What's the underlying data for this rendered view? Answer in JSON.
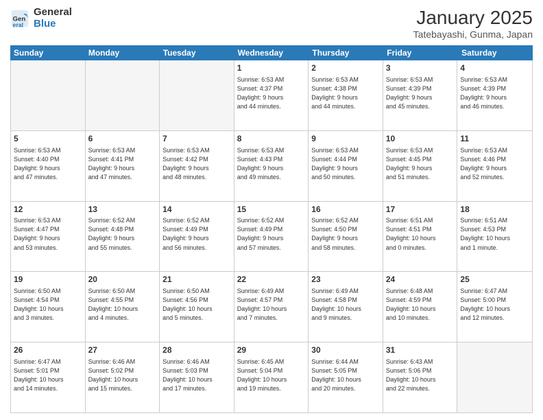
{
  "header": {
    "logo_general": "General",
    "logo_blue": "Blue",
    "month_title": "January 2025",
    "location": "Tatebayashi, Gunma, Japan"
  },
  "days_of_week": [
    "Sunday",
    "Monday",
    "Tuesday",
    "Wednesday",
    "Thursday",
    "Friday",
    "Saturday"
  ],
  "weeks": [
    [
      {
        "day": "",
        "info": ""
      },
      {
        "day": "",
        "info": ""
      },
      {
        "day": "",
        "info": ""
      },
      {
        "day": "1",
        "info": "Sunrise: 6:53 AM\nSunset: 4:37 PM\nDaylight: 9 hours\nand 44 minutes."
      },
      {
        "day": "2",
        "info": "Sunrise: 6:53 AM\nSunset: 4:38 PM\nDaylight: 9 hours\nand 44 minutes."
      },
      {
        "day": "3",
        "info": "Sunrise: 6:53 AM\nSunset: 4:39 PM\nDaylight: 9 hours\nand 45 minutes."
      },
      {
        "day": "4",
        "info": "Sunrise: 6:53 AM\nSunset: 4:39 PM\nDaylight: 9 hours\nand 46 minutes."
      }
    ],
    [
      {
        "day": "5",
        "info": "Sunrise: 6:53 AM\nSunset: 4:40 PM\nDaylight: 9 hours\nand 47 minutes."
      },
      {
        "day": "6",
        "info": "Sunrise: 6:53 AM\nSunset: 4:41 PM\nDaylight: 9 hours\nand 47 minutes."
      },
      {
        "day": "7",
        "info": "Sunrise: 6:53 AM\nSunset: 4:42 PM\nDaylight: 9 hours\nand 48 minutes."
      },
      {
        "day": "8",
        "info": "Sunrise: 6:53 AM\nSunset: 4:43 PM\nDaylight: 9 hours\nand 49 minutes."
      },
      {
        "day": "9",
        "info": "Sunrise: 6:53 AM\nSunset: 4:44 PM\nDaylight: 9 hours\nand 50 minutes."
      },
      {
        "day": "10",
        "info": "Sunrise: 6:53 AM\nSunset: 4:45 PM\nDaylight: 9 hours\nand 51 minutes."
      },
      {
        "day": "11",
        "info": "Sunrise: 6:53 AM\nSunset: 4:46 PM\nDaylight: 9 hours\nand 52 minutes."
      }
    ],
    [
      {
        "day": "12",
        "info": "Sunrise: 6:53 AM\nSunset: 4:47 PM\nDaylight: 9 hours\nand 53 minutes."
      },
      {
        "day": "13",
        "info": "Sunrise: 6:52 AM\nSunset: 4:48 PM\nDaylight: 9 hours\nand 55 minutes."
      },
      {
        "day": "14",
        "info": "Sunrise: 6:52 AM\nSunset: 4:49 PM\nDaylight: 9 hours\nand 56 minutes."
      },
      {
        "day": "15",
        "info": "Sunrise: 6:52 AM\nSunset: 4:49 PM\nDaylight: 9 hours\nand 57 minutes."
      },
      {
        "day": "16",
        "info": "Sunrise: 6:52 AM\nSunset: 4:50 PM\nDaylight: 9 hours\nand 58 minutes."
      },
      {
        "day": "17",
        "info": "Sunrise: 6:51 AM\nSunset: 4:51 PM\nDaylight: 10 hours\nand 0 minutes."
      },
      {
        "day": "18",
        "info": "Sunrise: 6:51 AM\nSunset: 4:53 PM\nDaylight: 10 hours\nand 1 minute."
      }
    ],
    [
      {
        "day": "19",
        "info": "Sunrise: 6:50 AM\nSunset: 4:54 PM\nDaylight: 10 hours\nand 3 minutes."
      },
      {
        "day": "20",
        "info": "Sunrise: 6:50 AM\nSunset: 4:55 PM\nDaylight: 10 hours\nand 4 minutes."
      },
      {
        "day": "21",
        "info": "Sunrise: 6:50 AM\nSunset: 4:56 PM\nDaylight: 10 hours\nand 5 minutes."
      },
      {
        "day": "22",
        "info": "Sunrise: 6:49 AM\nSunset: 4:57 PM\nDaylight: 10 hours\nand 7 minutes."
      },
      {
        "day": "23",
        "info": "Sunrise: 6:49 AM\nSunset: 4:58 PM\nDaylight: 10 hours\nand 9 minutes."
      },
      {
        "day": "24",
        "info": "Sunrise: 6:48 AM\nSunset: 4:59 PM\nDaylight: 10 hours\nand 10 minutes."
      },
      {
        "day": "25",
        "info": "Sunrise: 6:47 AM\nSunset: 5:00 PM\nDaylight: 10 hours\nand 12 minutes."
      }
    ],
    [
      {
        "day": "26",
        "info": "Sunrise: 6:47 AM\nSunset: 5:01 PM\nDaylight: 10 hours\nand 14 minutes."
      },
      {
        "day": "27",
        "info": "Sunrise: 6:46 AM\nSunset: 5:02 PM\nDaylight: 10 hours\nand 15 minutes."
      },
      {
        "day": "28",
        "info": "Sunrise: 6:46 AM\nSunset: 5:03 PM\nDaylight: 10 hours\nand 17 minutes."
      },
      {
        "day": "29",
        "info": "Sunrise: 6:45 AM\nSunset: 5:04 PM\nDaylight: 10 hours\nand 19 minutes."
      },
      {
        "day": "30",
        "info": "Sunrise: 6:44 AM\nSunset: 5:05 PM\nDaylight: 10 hours\nand 20 minutes."
      },
      {
        "day": "31",
        "info": "Sunrise: 6:43 AM\nSunset: 5:06 PM\nDaylight: 10 hours\nand 22 minutes."
      },
      {
        "day": "",
        "info": ""
      }
    ]
  ]
}
